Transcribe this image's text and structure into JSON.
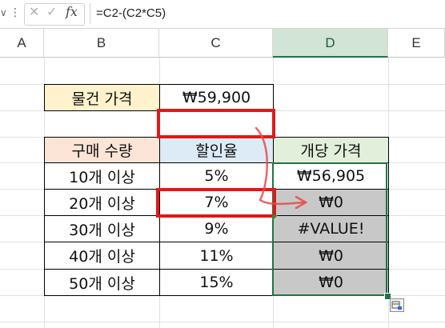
{
  "formula_bar": {
    "name_box_arrow": "∨",
    "menu_icon": "more-vert-icon",
    "cancel_glyph": "✕",
    "enter_glyph": "✓",
    "fx_label": "fx",
    "formula": "=C2-(C2*C5)"
  },
  "columns": [
    "A",
    "B",
    "C",
    "D",
    "E"
  ],
  "selected_column": "D",
  "table": {
    "price_label": "물건 가격",
    "price_value": "₩59,900",
    "header": [
      "구매 수량",
      "할인율",
      "개당 가격"
    ],
    "rows": [
      {
        "qty": "10개 이상",
        "rate": "5%",
        "unit_price": "₩56,905"
      },
      {
        "qty": "20개 이상",
        "rate": "7%",
        "unit_price": "₩0"
      },
      {
        "qty": "30개 이상",
        "rate": "9%",
        "unit_price": "#VALUE!"
      },
      {
        "qty": "40개 이상",
        "rate": "11%",
        "unit_price": "₩0"
      },
      {
        "qty": "50개 이상",
        "rate": "15%",
        "unit_price": "₩0"
      }
    ]
  },
  "colors": {
    "price_label_bg": "#fff2cc",
    "qty_header_bg": "#fce4d6",
    "rate_header_bg": "#ddebf7",
    "unit_header_bg": "#e2efda",
    "selected_gray": "#c8c8c8",
    "annotation_red": "#e01919",
    "excel_green": "#217346"
  }
}
